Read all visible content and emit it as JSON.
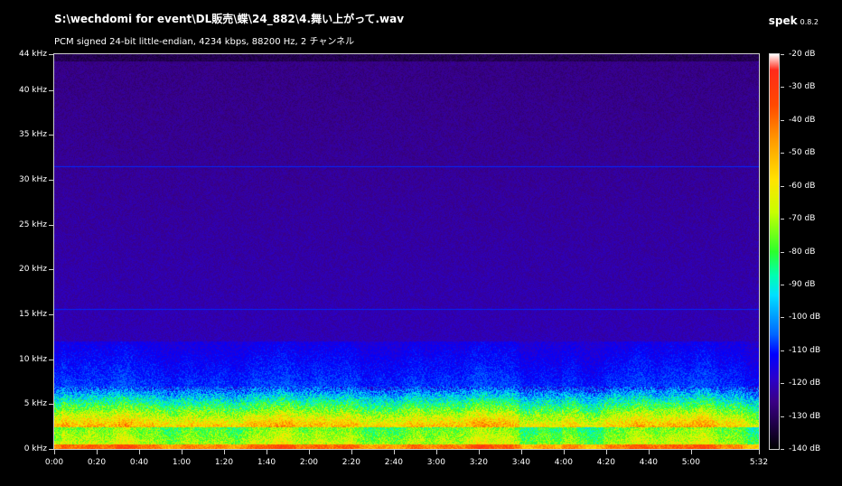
{
  "window": {
    "file_path": "S:\\wechdomi for event\\DL販売\\蝶\\24_882\\4.舞い上がって.wav",
    "stream_info": "PCM signed 24-bit little-endian, 4234 kbps, 88200 Hz, 2 チャンネル",
    "app_name": "spek",
    "app_version": "0.8.2"
  },
  "colors": {
    "background": "#000000",
    "frame": "#cfcfcf",
    "text": "#ffffff",
    "spectrum_low": "#1a0040",
    "spectrum_high": "#ff0000"
  },
  "chart_data": {
    "type": "heatmap",
    "title": "",
    "xlabel": "",
    "ylabel": "",
    "x_ticks": [
      "0:00",
      "0:20",
      "0:40",
      "1:00",
      "1:20",
      "1:40",
      "2:00",
      "2:20",
      "2:40",
      "3:00",
      "3:20",
      "3:40",
      "4:00",
      "4:20",
      "4:40",
      "5:00",
      "5:32"
    ],
    "x_tick_seconds": [
      0,
      20,
      40,
      60,
      80,
      100,
      120,
      140,
      160,
      180,
      200,
      220,
      240,
      260,
      280,
      300,
      332
    ],
    "xlim": [
      0,
      332
    ],
    "y_ticks": [
      "0 kHz",
      "5 kHz",
      "10 kHz",
      "15 kHz",
      "20 kHz",
      "25 kHz",
      "30 kHz",
      "35 kHz",
      "40 kHz",
      "44 kHz"
    ],
    "y_tick_khz": [
      0,
      5,
      10,
      15,
      20,
      25,
      30,
      35,
      40,
      44
    ],
    "ylim": [
      0,
      44
    ],
    "colorbar_ticks": [
      "-20 dB",
      "-30 dB",
      "-40 dB",
      "-50 dB",
      "-60 dB",
      "-70 dB",
      "-80 dB",
      "-90 dB",
      "-100 dB",
      "-110 dB",
      "-120 dB",
      "-130 dB",
      "-140 dB"
    ],
    "colorbar_db": [
      -20,
      -30,
      -40,
      -50,
      -60,
      -70,
      -80,
      -90,
      -100,
      -110,
      -120,
      -130,
      -140
    ],
    "colorbar_range": [
      -140,
      -20
    ],
    "horizontal_lines_khz": [
      31.5,
      15.6
    ],
    "energy_band_top_khz": 7
  }
}
